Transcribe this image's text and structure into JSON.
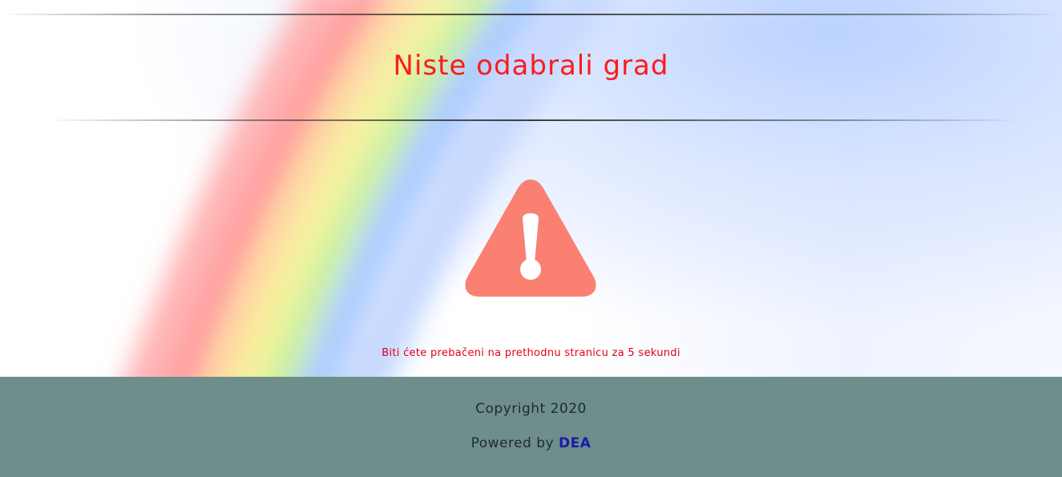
{
  "page": {
    "title": "Niste odabrali grad",
    "redirect_message": "Biti ćete prebačeni na prethodnu stranicu za 5 sekundi",
    "warning_icon": "warning-triangle-exclamation"
  },
  "footer": {
    "copyright": "Copyright 2020",
    "powered_prefix": "Powered by ",
    "powered_link": "DEA"
  },
  "colors": {
    "title": "#ff1a1a",
    "redirect_text": "#e0001b",
    "warning_icon": "#fa8072",
    "footer_bg": "#6e8e8b",
    "footer_text": "#1f2a2a",
    "link": "#1a1aa8"
  }
}
